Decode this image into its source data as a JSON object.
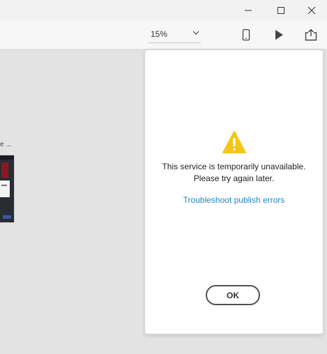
{
  "window_controls": {
    "minimize_icon": "minimize-icon",
    "maximize_icon": "maximize-icon",
    "close_icon": "close-icon"
  },
  "toolbar": {
    "zoom_value": "15%",
    "device_icon": "phone-icon",
    "play_icon": "play-icon",
    "share_icon": "share-icon"
  },
  "canvas": {
    "artboard_label": "e ..."
  },
  "dialog": {
    "icon": "warning-icon",
    "icon_color": "#f5c518",
    "message_line1": "This service is temporarily unavailable.",
    "message_line2": "Please try again later.",
    "link_text": "Troubleshoot publish errors",
    "link_color": "#1f86c7",
    "ok_label": "OK"
  }
}
